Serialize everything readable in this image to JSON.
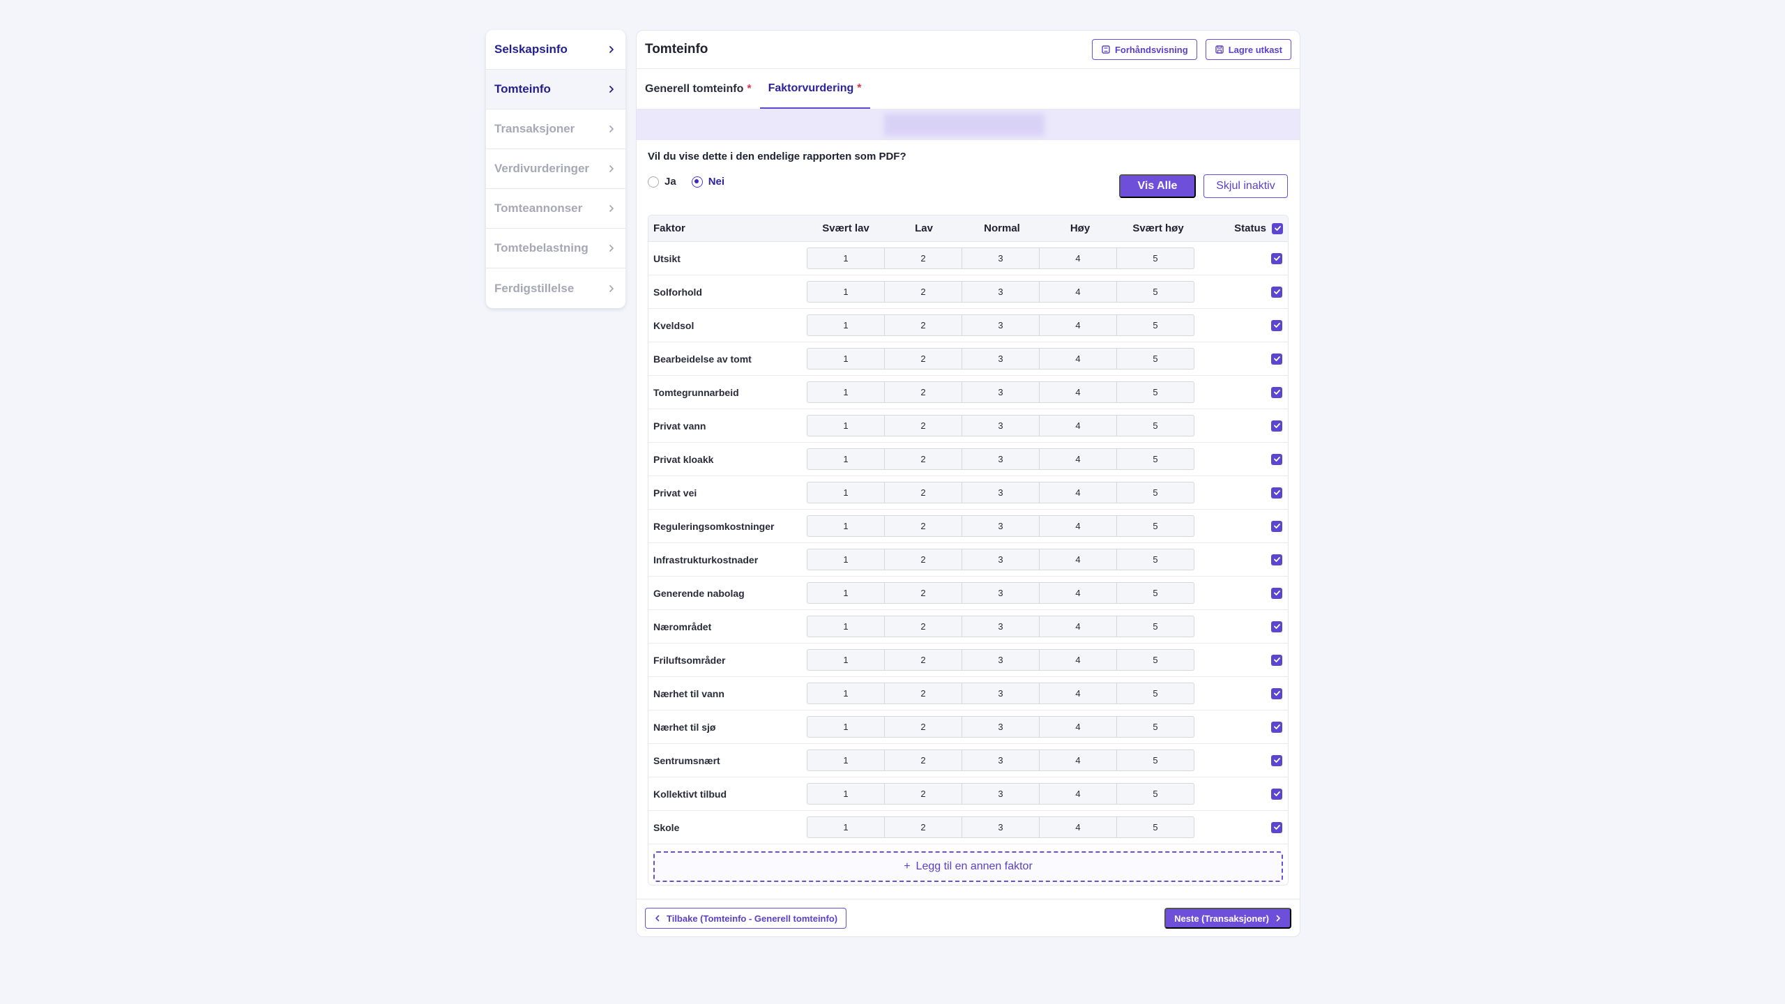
{
  "sidebar": {
    "items": [
      {
        "label": "Selskapsinfo",
        "state": "active"
      },
      {
        "label": "Tomteinfo",
        "state": "current"
      },
      {
        "label": "Transaksjoner",
        "state": "disabled"
      },
      {
        "label": "Verdivurderinger",
        "state": "disabled"
      },
      {
        "label": "Tomteannonser",
        "state": "disabled"
      },
      {
        "label": "Tomtebelastning",
        "state": "disabled"
      },
      {
        "label": "Ferdigstillelse",
        "state": "disabled"
      }
    ]
  },
  "header": {
    "title": "Tomteinfo",
    "preview_label": "Forhåndsvisning",
    "save_draft_label": "Lagre utkast"
  },
  "tabs": [
    {
      "label": "Generell tomteinfo",
      "required": "*"
    },
    {
      "label": "Faktorvurdering",
      "required": "*"
    }
  ],
  "pdf_question": {
    "text": "Vil du vise dette i den endelige rapporten som PDF?",
    "options": [
      "Ja",
      "Nei"
    ],
    "selected": "Nei"
  },
  "filters": {
    "show_all_label": "Vis Alle",
    "hide_inactive_label": "Skjul inaktiv"
  },
  "table": {
    "headers": {
      "factor": "Faktor",
      "scores": [
        "Svært lav",
        "Lav",
        "Normal",
        "Høy",
        "Svært høy"
      ],
      "status": "Status"
    },
    "score_values": [
      "1",
      "2",
      "3",
      "4",
      "5"
    ],
    "rows": [
      "Utsikt",
      "Solforhold",
      "Kveldsol",
      "Bearbeidelse av tomt",
      "Tomtegrunnarbeid",
      "Privat vann",
      "Privat kloakk",
      "Privat vei",
      "Reguleringsomkostninger",
      "Infrastrukturkostnader",
      "Generende nabolag",
      "Nærområdet",
      "Friluftsområder",
      "Nærhet til vann",
      "Nærhet til sjø",
      "Sentrumsnært",
      "Kollektivt tilbud",
      "Skole"
    ],
    "add_factor_label": "Legg til en annen faktor"
  },
  "footer": {
    "back_label": "Tilbake (Tomteinfo - Generell tomteinfo)",
    "next_label": "Neste (Transaksjoner)"
  },
  "colors": {
    "accent": "#6e4fd9",
    "active_text": "#241f91",
    "disabled_text": "#a6a8b6",
    "required": "#e0344a"
  }
}
